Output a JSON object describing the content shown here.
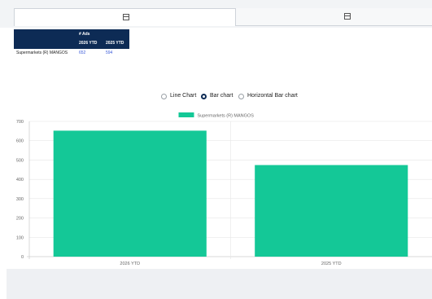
{
  "tabs": [
    {
      "icon": "table-icon",
      "active": true
    },
    {
      "icon": "table-icon",
      "active": false
    }
  ],
  "table": {
    "metric_header": "# Ads",
    "columns": [
      "2026 YTD",
      "2025 YTD"
    ],
    "rows": [
      {
        "label": "Supermarkets (R)  MANGOS",
        "values": [
          "652",
          "594"
        ]
      }
    ]
  },
  "chart_options": {
    "options": [
      "Line Chart",
      "Bar chart",
      "Horizontal Bar chart"
    ],
    "selected": "Bar chart"
  },
  "chart_data": {
    "type": "bar",
    "categories": [
      "2026 YTD",
      "2025 YTD"
    ],
    "series": [
      {
        "name": "Supermarkets (R) MANGOS",
        "values": [
          652,
          474
        ],
        "color": "#14c897"
      }
    ],
    "ylim": [
      0,
      700
    ],
    "yticks": [
      0,
      100,
      200,
      300,
      400,
      500,
      600,
      700
    ],
    "legend": "top-center",
    "grid": true
  }
}
